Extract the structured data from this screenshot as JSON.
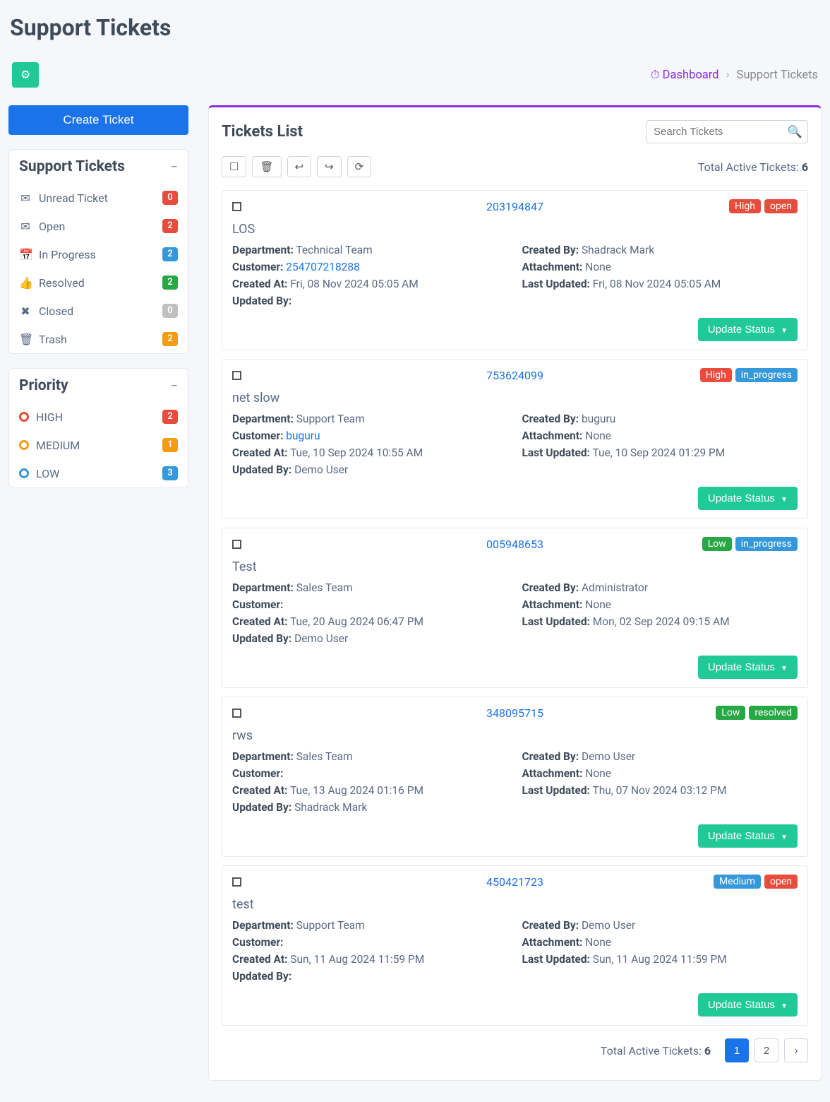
{
  "page": {
    "title": "Support Tickets"
  },
  "breadcrumb": {
    "home": "Dashboard",
    "current": "Support Tickets",
    "sep": "›"
  },
  "create_btn": "Create Ticket",
  "sidebar": {
    "status_title": "Support Tickets",
    "status_items": [
      {
        "icon": "✉",
        "label": "Unread Ticket",
        "count": "0",
        "badge": "red"
      },
      {
        "icon": "✉",
        "label": "Open",
        "count": "2",
        "badge": "red"
      },
      {
        "icon": "📅",
        "label": "In Progress",
        "count": "2",
        "badge": "blue"
      },
      {
        "icon": "👍",
        "label": "Resolved",
        "count": "2",
        "badge": "green"
      },
      {
        "icon": "✖",
        "label": "Closed",
        "count": "0",
        "badge": "grey"
      },
      {
        "icon": "🗑",
        "label": "Trash",
        "count": "2",
        "badge": "orange"
      }
    ],
    "priority_title": "Priority",
    "priority_items": [
      {
        "color": "red",
        "label": "HIGH",
        "count": "2",
        "badge": "red"
      },
      {
        "color": "orange",
        "label": "MEDIUM",
        "count": "1",
        "badge": "orange"
      },
      {
        "color": "blue",
        "label": "LOW",
        "count": "3",
        "badge": "blue"
      }
    ]
  },
  "list": {
    "title": "Tickets List",
    "search_placeholder": "Search Tickets",
    "total_label": "Total Active Tickets:",
    "total_count": "6",
    "update_btn": "Update Status"
  },
  "fields": {
    "department": "Department:",
    "created_by": "Created By:",
    "customer": "Customer:",
    "attachment": "Attachment:",
    "created_at": "Created At:",
    "last_updated": "Last Updated:",
    "updated_by": "Updated By:"
  },
  "tickets": [
    {
      "id": "203194847",
      "priority": "High",
      "priority_cls": "high",
      "status": "open",
      "status_cls": "open",
      "title": "LOS",
      "department": "Technical Team",
      "created_by": "Shadrack Mark",
      "customer": "254707218288",
      "customer_link": true,
      "attachment": "None",
      "created_at": "Fri, 08 Nov 2024 05:05 AM",
      "last_updated": "Fri, 08 Nov 2024 05:05 AM",
      "updated_by": ""
    },
    {
      "id": "753624099",
      "priority": "High",
      "priority_cls": "high",
      "status": "in_progress",
      "status_cls": "inprogress",
      "title": "net slow",
      "department": "Support Team",
      "created_by": "buguru",
      "customer": "buguru",
      "customer_link": true,
      "attachment": "None",
      "created_at": "Tue, 10 Sep 2024 10:55 AM",
      "last_updated": "Tue, 10 Sep 2024 01:29 PM",
      "updated_by": "Demo User"
    },
    {
      "id": "005948653",
      "priority": "Low",
      "priority_cls": "low",
      "status": "in_progress",
      "status_cls": "inprogress",
      "title": "Test",
      "department": "Sales Team",
      "created_by": "Administrator",
      "customer": "",
      "customer_link": false,
      "attachment": "None",
      "created_at": "Tue, 20 Aug 2024 06:47 PM",
      "last_updated": "Mon, 02 Sep 2024 09:15 AM",
      "updated_by": "Demo User"
    },
    {
      "id": "348095715",
      "priority": "Low",
      "priority_cls": "low",
      "status": "resolved",
      "status_cls": "resolved",
      "title": "rws",
      "department": "Sales Team",
      "created_by": "Demo User",
      "customer": "",
      "customer_link": false,
      "attachment": "None",
      "created_at": "Tue, 13 Aug 2024 01:16 PM",
      "last_updated": "Thu, 07 Nov 2024 03:12 PM",
      "updated_by": "Shadrack Mark"
    },
    {
      "id": "450421723",
      "priority": "Medium",
      "priority_cls": "medium",
      "status": "open",
      "status_cls": "open",
      "title": "test",
      "department": "Support Team",
      "created_by": "Demo User",
      "customer": "",
      "customer_link": false,
      "attachment": "None",
      "created_at": "Sun, 11 Aug 2024 11:59 PM",
      "last_updated": "Sun, 11 Aug 2024 11:59 PM",
      "updated_by": ""
    }
  ],
  "pagination": {
    "pages": [
      "1",
      "2"
    ],
    "active": 0
  }
}
